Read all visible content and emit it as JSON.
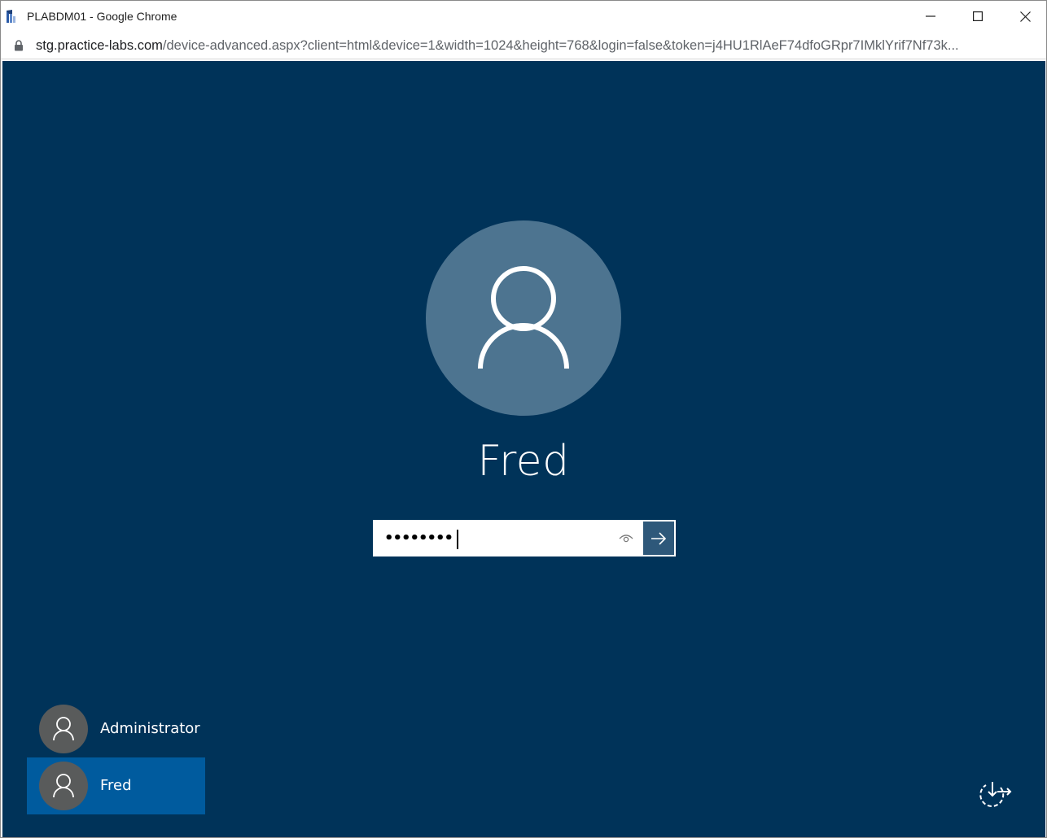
{
  "window": {
    "title": "PLABDM01 - Google Chrome",
    "app_icon": "practice-labs-logo-icon"
  },
  "address_bar": {
    "url_host": "stg.practice-labs.com",
    "url_path": "/device-advanced.aspx?client=html&device=1&width=1024&height=768&login=false&token=j4HU1RlAeF74dfoGRpr7IMklYrif7Nf73k...",
    "secure_icon": "lock-icon"
  },
  "login": {
    "current_user": "Fred",
    "password_masked": "••••••••",
    "reveal_icon": "eye-icon",
    "submit_icon": "arrow-right-icon"
  },
  "users": [
    {
      "name": "Administrator",
      "selected": false
    },
    {
      "name": "Fred",
      "selected": true
    }
  ],
  "colors": {
    "background": "#003359",
    "avatar_large": "#4d7490",
    "avatar_small": "#595b5b",
    "selected_tile": "#005b9e",
    "submit_button": "#2e587a"
  },
  "bottom_right_icon": "ease-of-access-power-icon"
}
